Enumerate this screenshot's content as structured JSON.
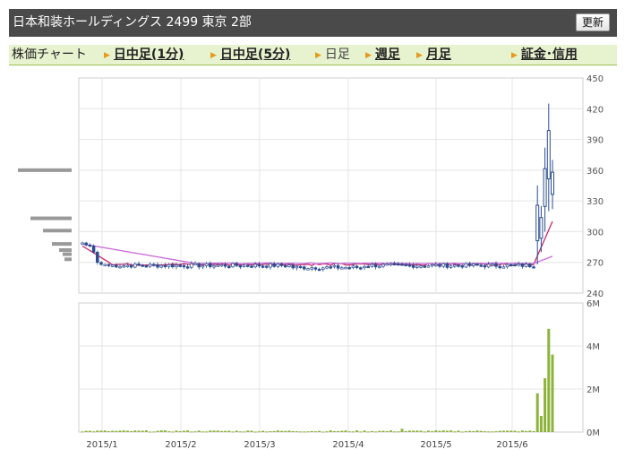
{
  "header": {
    "title": "日本和装ホールディングス  2499  東京 2部",
    "refresh_label": "更新"
  },
  "tabs": [
    {
      "label": "株価チャート",
      "kind": "label"
    },
    {
      "label": "日中足(1分)",
      "kind": "link"
    },
    {
      "label": "日中足(5分)",
      "kind": "link"
    },
    {
      "label": "日足",
      "kind": "plain"
    },
    {
      "label": "週足",
      "kind": "link"
    },
    {
      "label": "月足",
      "kind": "link"
    },
    {
      "label": "証金･信用",
      "kind": "link"
    }
  ],
  "colors": {
    "accent": "#9cbf52",
    "candle": "#2a4d8f",
    "ma_short": "#c8286e",
    "ma_long": "#c86ad8",
    "volume": "#8db33a",
    "profile": "#999999"
  },
  "chart_data": [
    {
      "type": "candlestick",
      "title": "",
      "x_tick_labels": [
        "2015/1",
        "2015/2",
        "2015/3",
        "2015/4",
        "2015/5",
        "2015/6"
      ],
      "y_tick_labels": [
        "450",
        "420",
        "390",
        "360",
        "330",
        "300",
        "270",
        "240"
      ],
      "ylim": [
        240,
        450
      ],
      "grid": true,
      "price_series": {
        "start": [
          289,
          287,
          286,
          280,
          270,
          268,
          268
        ],
        "end_dates": [
          "2015/6"
        ],
        "base_level": 267,
        "spikes": [
          {
            "high": 345,
            "low": 268
          },
          {
            "high": 325,
            "low": 280
          },
          {
            "high": 382,
            "low": 300
          },
          {
            "high": 425,
            "low": 320
          },
          {
            "high": 370,
            "low": 322
          }
        ]
      },
      "moving_averages": [
        {
          "color_key": "ma_short",
          "start": 286,
          "mid": 268,
          "end": 310
        },
        {
          "color_key": "ma_long",
          "start": 288,
          "mid": 269,
          "end": 276
        }
      ]
    },
    {
      "type": "bar",
      "title": "",
      "y_tick_labels": [
        "6M",
        "4M",
        "2M",
        "0M"
      ],
      "ylim": [
        0,
        6000000
      ],
      "recent_volumes": [
        1800000,
        750000,
        2500000,
        4800000,
        3600000
      ]
    }
  ]
}
